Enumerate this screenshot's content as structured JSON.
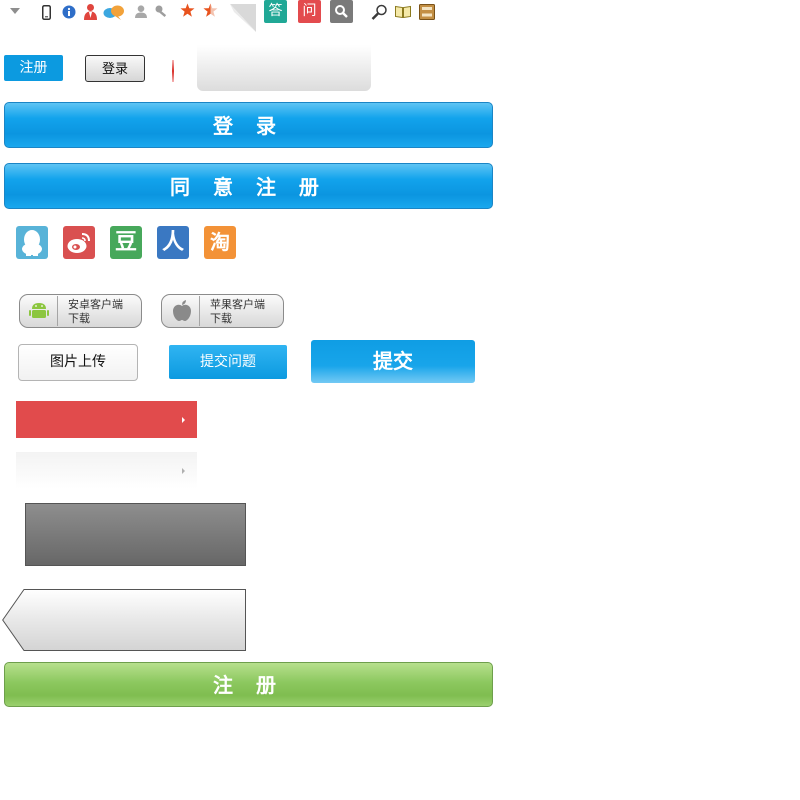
{
  "icon_bar": {
    "icons": [
      "dropdown-triangle-icon",
      "mobile-phone-icon",
      "info-icon",
      "user-icon",
      "chat-bubbles-icon",
      "person-icon",
      "key-icon",
      "star-icon",
      "half-star-icon",
      "page-corner-icon",
      "answer-badge-icon",
      "question-badge-icon",
      "search-badge-icon",
      "magnifier-icon",
      "open-book-icon",
      "bookshelf-icon"
    ],
    "answer_badge_label": "答",
    "question_badge_label": "问"
  },
  "buttons": {
    "register_small": "注册",
    "login_small": "登录",
    "login_wide": "登 录",
    "agree_register": "同 意 注 册",
    "upload_image": "图片上传",
    "submit_question": "提交问题",
    "submit": "提交",
    "register_wide": "注 册"
  },
  "social_login": {
    "icons": [
      "qq-icon",
      "weibo-icon",
      "douban-icon",
      "renren-icon",
      "taobao-icon"
    ],
    "douban_glyph": "豆",
    "renren_glyph": "人",
    "taobao_glyph": "淘"
  },
  "app_downloads": {
    "android": "安卓客户端\n下载",
    "ios": "苹果客户端\n下载"
  },
  "colors": {
    "primary_blue": "#0c9ae0",
    "register_green": "#8cc85f",
    "alert_red": "#e14b4c",
    "qq": "#58b3d8",
    "weibo": "#d95050",
    "douban": "#47a85b",
    "renren": "#3a78c2",
    "taobao": "#f39237"
  }
}
